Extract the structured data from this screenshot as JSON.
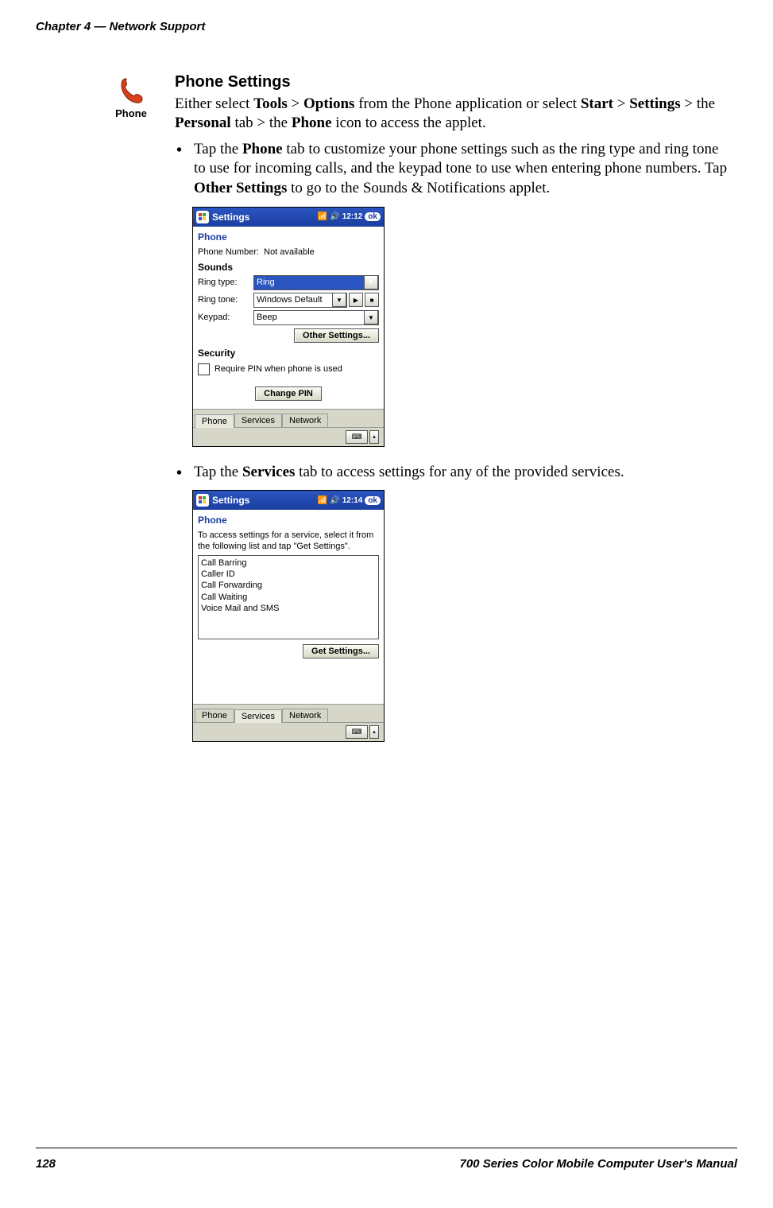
{
  "header": {
    "left": "Chapter 4  —  Network Support"
  },
  "icon": {
    "name": "phone-icon",
    "label": "Phone"
  },
  "section": {
    "title": "Phone Settings"
  },
  "intro": {
    "p1a": "Either select ",
    "p1b": "Tools",
    "p1c": " > ",
    "p1d": "Options",
    "p1e": " from the Phone application or select ",
    "p1f": "Start",
    "p1g": " > ",
    "p1h": "Settings",
    "p1i": " > the ",
    "p1j": "Personal",
    "p1k": " tab > the ",
    "p1l": "Phone",
    "p1m": " icon to access the applet."
  },
  "bullet1": {
    "a": "Tap the ",
    "b": "Phone",
    "c": " tab to customize your phone settings such as the ring type and ring tone to use for incoming calls, and the keypad tone to use when entering phone numbers. Tap ",
    "d": "Other Settings",
    "e": " to go to the Sounds & Notifications applet."
  },
  "bullet2": {
    "a": "Tap the ",
    "b": "Services",
    "c": " tab to access settings for any of the provided services."
  },
  "ss1": {
    "titlebar": "Settings",
    "time": "12:12",
    "ok": "ok",
    "heading": "Phone",
    "phone_number_label": "Phone Number:",
    "phone_number_value": "Not available",
    "sounds_label": "Sounds",
    "ringtype_label": "Ring type:",
    "ringtype_value": "Ring",
    "ringtone_label": "Ring tone:",
    "ringtone_value": "Windows Default",
    "keypad_label": "Keypad:",
    "keypad_value": "Beep",
    "other_settings_btn": "Other Settings...",
    "security_label": "Security",
    "pin_checkbox": "Require PIN when phone is used",
    "change_pin_btn": "Change PIN",
    "tabs": {
      "phone": "Phone",
      "services": "Services",
      "network": "Network"
    }
  },
  "ss2": {
    "titlebar": "Settings",
    "time": "12:14",
    "ok": "ok",
    "heading": "Phone",
    "desc": "To access settings for a service, select it from the following list and tap \"Get Settings\".",
    "list": [
      "Call Barring",
      "Caller ID",
      "Call Forwarding",
      "Call Waiting",
      "Voice Mail and SMS"
    ],
    "get_settings_btn": "Get Settings...",
    "tabs": {
      "phone": "Phone",
      "services": "Services",
      "network": "Network"
    }
  },
  "footer": {
    "page": "128",
    "manual": "700 Series Color Mobile Computer User's Manual"
  }
}
